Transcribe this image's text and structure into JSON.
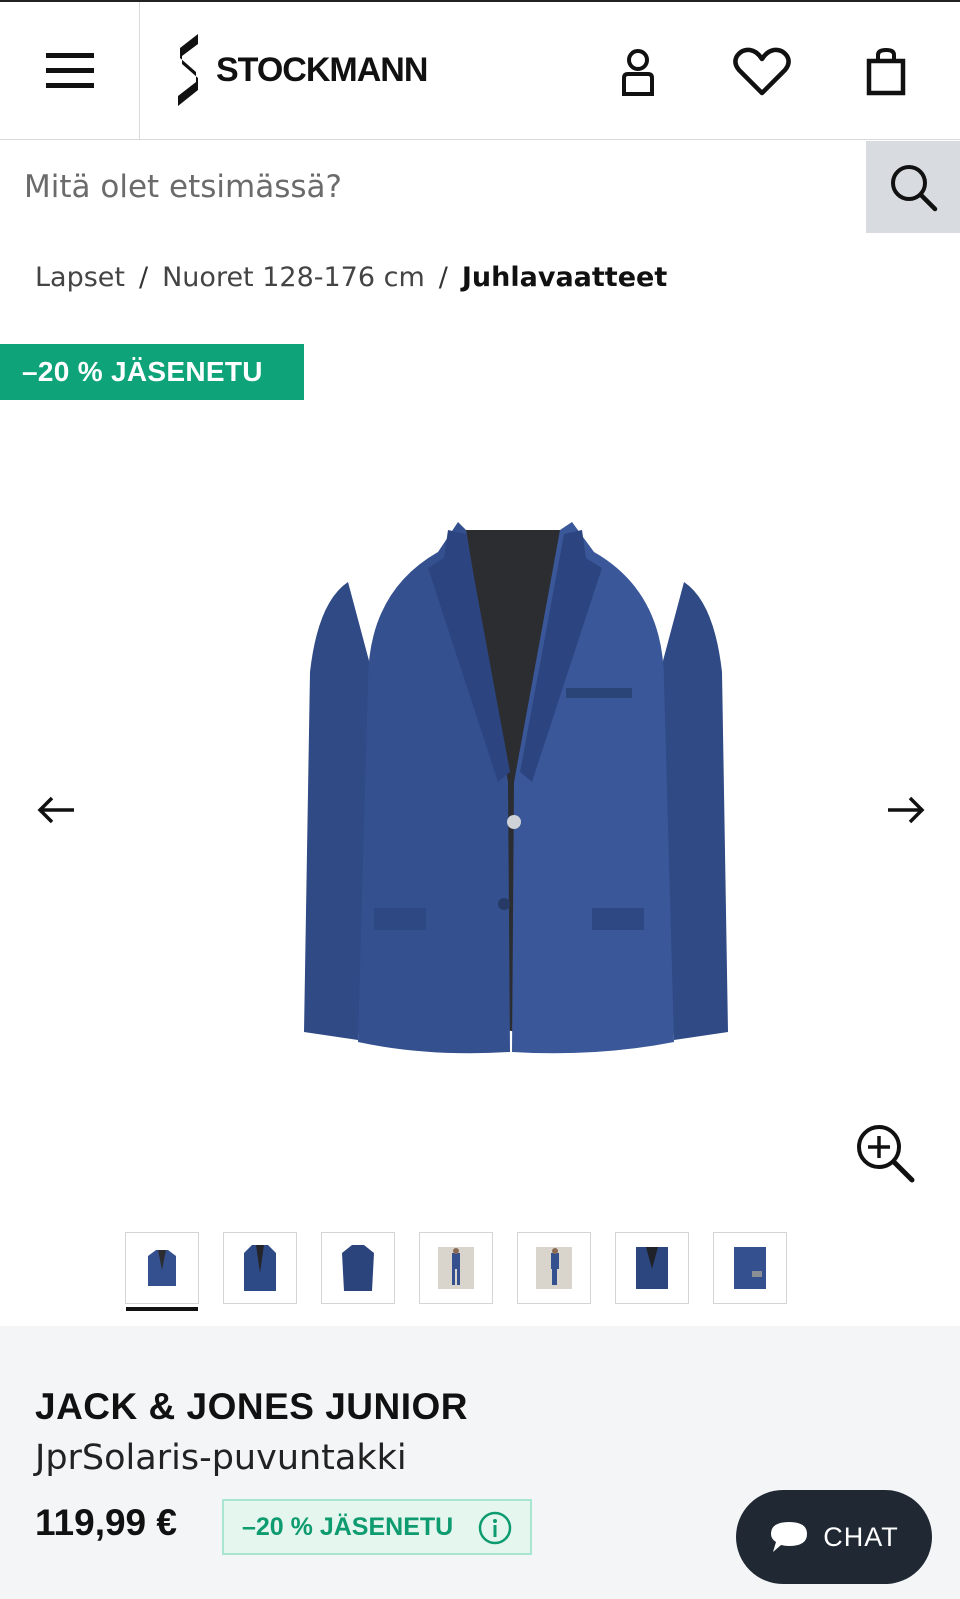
{
  "header": {
    "brand": "STOCKMANN",
    "menu_icon": "hamburger-menu-icon",
    "account_icon": "user-icon",
    "wishlist_icon": "heart-icon",
    "cart_icon": "shopping-bag-icon"
  },
  "search": {
    "placeholder": "Mitä olet etsimässä?",
    "icon": "search-icon"
  },
  "breadcrumb": {
    "items": [
      "Lapset",
      "Nuoret 128-176 cm"
    ],
    "separator": "/",
    "current": "Juhlavaatteet"
  },
  "promo_badge": "–20 % JÄSENETU",
  "gallery": {
    "prev_icon": "arrow-left-icon",
    "next_icon": "arrow-right-icon",
    "zoom_icon": "zoom-in-icon",
    "thumbnail_count": 7,
    "active_index": 0
  },
  "product": {
    "brand": "JACK & JONES JUNIOR",
    "name": "JprSolaris-puvuntakki",
    "price": "119,99 €",
    "member_badge": "–20 % JÄSENETU",
    "member_info_icon": "info-icon"
  },
  "chat": {
    "label": "CHAT",
    "icon": "chat-bubble-icon"
  },
  "colors": {
    "promo_green": "#0fa37a",
    "badge_bg": "#e5f6ee",
    "chat_bg": "#1f2833",
    "jacket_blue": "#34508f"
  }
}
